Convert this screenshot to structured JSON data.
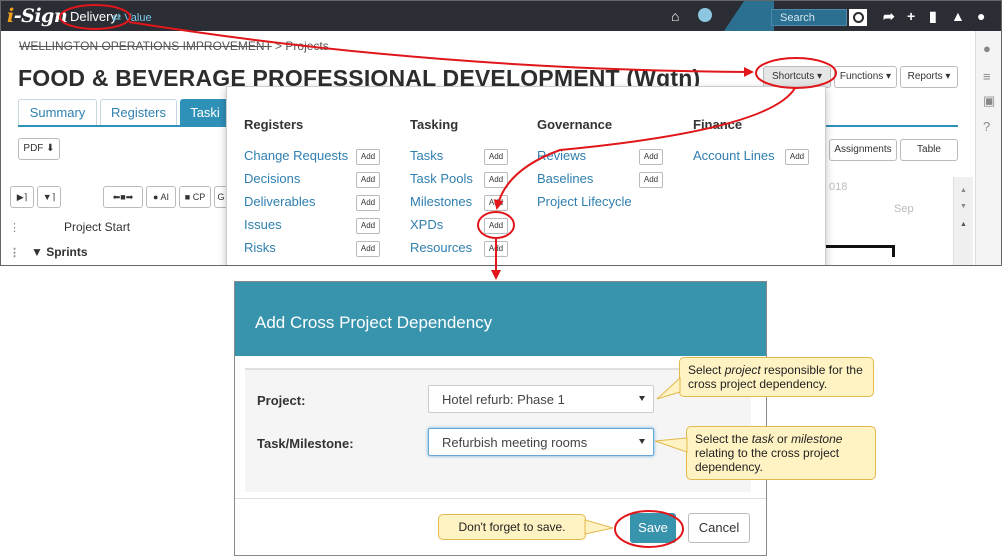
{
  "topbar": {
    "logo": "i-Sign",
    "logo_i": "i",
    "logo_rest": "-Sign",
    "nav_active": "Delivery",
    "nav_other": "⇄ Value",
    "search_placeholder": "Search"
  },
  "breadcrumb": {
    "org": "WELLINGTON OPERATIONS IMPROVEMENT",
    "sep": " > ",
    "page": "Projects"
  },
  "page_title": "FOOD & BEVERAGE PROFESSIONAL DEVELOPMENT (Wgtn)",
  "header_buttons": {
    "shortcuts": "Shortcuts ▾",
    "functions": "Functions ▾",
    "reports": "Reports ▾"
  },
  "tabs": [
    "Summary",
    "Registers",
    "Taski"
  ],
  "pdf_label": "PDF ⬇",
  "view_buttons": {
    "assignments": "Assignments",
    "table": "Table"
  },
  "toolbar": {
    "b1": "▶⌉",
    "b2": "▼⌉",
    "b3": "⬅■➡",
    "b4": "● AI",
    "b5": "■ CP",
    "b6": "G"
  },
  "gantt": {
    "year_fragment": "018",
    "month": "Sep"
  },
  "task_rows": [
    {
      "label": "Project Start",
      "bold": false
    },
    {
      "label": "▼  Sprints",
      "bold": true
    }
  ],
  "shortcuts_menu": {
    "add_label": "Add",
    "columns": [
      {
        "heading": "Registers",
        "items": [
          "Change Requests",
          "Decisions",
          "Deliverables",
          "Issues",
          "Risks"
        ]
      },
      {
        "heading": "Tasking",
        "items": [
          "Tasks",
          "Task Pools",
          "Milestones",
          "XPDs",
          "Resources"
        ]
      },
      {
        "heading": "Governance",
        "items": [
          "Reviews",
          "Baselines",
          "Project Lifecycle"
        ]
      },
      {
        "heading": "Finance",
        "items": [
          "Account Lines"
        ]
      }
    ]
  },
  "modal": {
    "title": "Add Cross Project Dependency",
    "project_label": "Project:",
    "project_value": "Hotel refurb: Phase 1",
    "task_label": "Task/Milestone:",
    "task_value": "Refurbish meeting rooms",
    "save": "Save",
    "cancel": "Cancel"
  },
  "callouts": {
    "project_a": "Select ",
    "project_em": "project",
    "project_b": " responsible for the cross project dependency.",
    "task_a": "Select the ",
    "task_em1": "task",
    "task_mid": " or ",
    "task_em2": "milestone",
    "task_b": " relating to the cross project dependency.",
    "save": "Don't forget to save."
  },
  "colors": {
    "annotation_red": "#e0161a",
    "accent_teal": "#3893ad",
    "link_blue": "#2f7fb0",
    "callout_bg": "#fff3c4"
  }
}
